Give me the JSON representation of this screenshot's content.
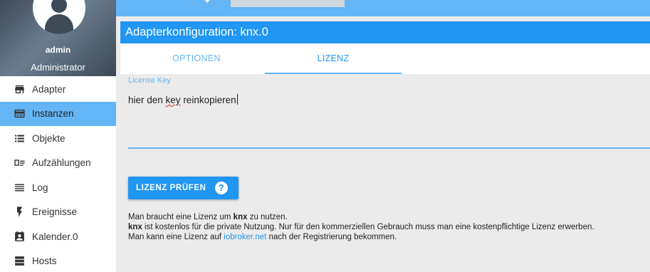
{
  "profile": {
    "name": "admin",
    "role": "Administrator"
  },
  "sidebar": {
    "items": [
      {
        "label": "Adapter",
        "icon": "store-icon"
      },
      {
        "label": "Instanzen",
        "icon": "instances-icon",
        "active": true
      },
      {
        "label": "Objekte",
        "icon": "list-icon"
      },
      {
        "label": "Aufzählungen",
        "icon": "enum-icon"
      },
      {
        "label": "Log",
        "icon": "log-icon"
      },
      {
        "label": "Ereignisse",
        "icon": "flash-icon"
      },
      {
        "label": "Kalender.0",
        "icon": "calendar-icon"
      },
      {
        "label": "Hosts",
        "icon": "hosts-icon"
      }
    ]
  },
  "dialog": {
    "title": "Adapterkonfiguration: knx.0",
    "tabs": [
      "OPTIONEN",
      "LIZENZ"
    ],
    "active_tab": "LIZENZ"
  },
  "license": {
    "label": "License Key",
    "value_pre": "hier den ",
    "value_typo": "key",
    "value_post": " reinkopieren",
    "button": "LIZENZ PRÜFEN",
    "help_glyph": "?"
  },
  "info": {
    "line1_pre": "Man braucht eine Lizenz um ",
    "line1_bold": "knx",
    "line1_post": " zu nutzen.",
    "line2_bold": "knx",
    "line2_post": " ist kostenlos für die private Nutzung. Nur für den kommerziellen Gebrauch muss man eine kostenpflichtige Lizenz erwerben.",
    "line3_pre": "Man kann eine Lizenz auf ",
    "line3_link": "iobroker.net",
    "line3_post": " nach der Registrierung bekommen."
  },
  "colors": {
    "accent": "#2196f3",
    "accent_light": "#64b5f6",
    "background": "#ebebeb"
  }
}
